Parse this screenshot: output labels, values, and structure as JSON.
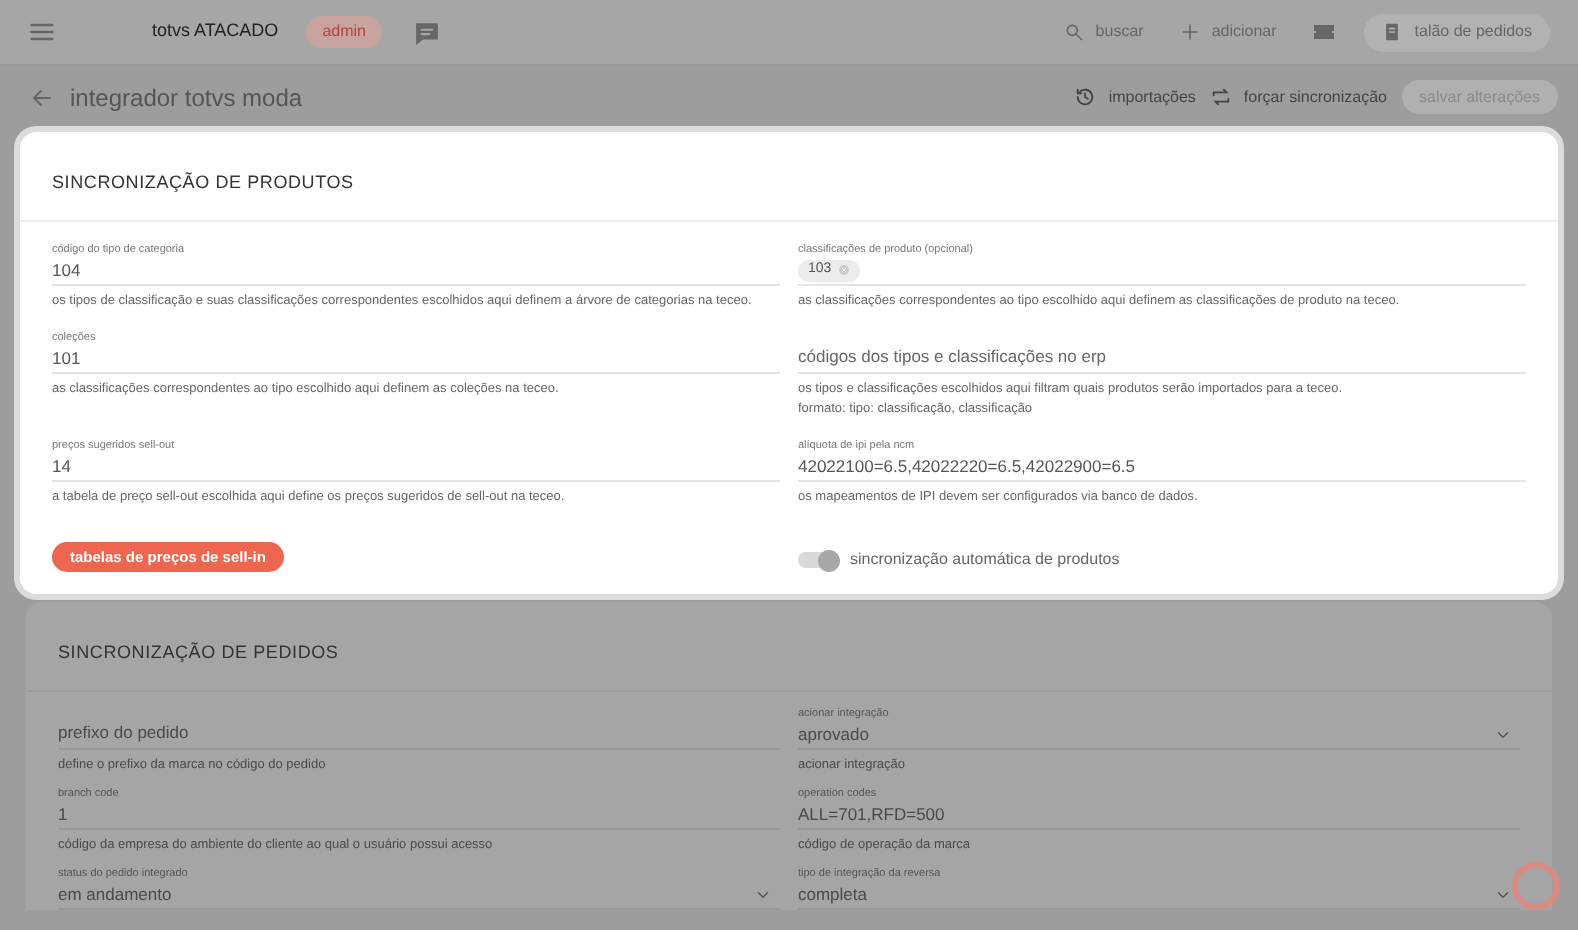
{
  "topbar": {
    "brand": "totvs ATACADO",
    "role_badge": "admin",
    "actions": [
      {
        "kind": "search",
        "label": "buscar"
      },
      {
        "kind": "add",
        "label": "adicionar"
      },
      {
        "kind": "ticket"
      }
    ],
    "orders_button": "talão de pedidos"
  },
  "subheader": {
    "title": "integrador totvs moda",
    "actions": [
      {
        "kind": "history",
        "label": "importações"
      },
      {
        "kind": "sync",
        "label": "forçar sincronização"
      }
    ],
    "save_button": {
      "label": "salvar alterações",
      "disabled": true
    }
  },
  "sections": [
    {
      "title": "SINCRONIZAÇÃO DE PRODUTOS",
      "highlighted": true,
      "rows": [
        [
          {
            "kind": "input",
            "label": "código do tipo de categoria",
            "value": "104",
            "help": [
              "os tipos de classificação e suas classificações correspondentes escolhidos aqui definem a árvore de categorias na teceo."
            ]
          },
          {
            "kind": "chips",
            "label": "classificações de produto (opcional)",
            "chips": [
              "103"
            ],
            "help": [
              "as classificações correspondentes ao tipo escolhido aqui definem as classificações de produto na teceo."
            ]
          }
        ],
        [
          {
            "kind": "input",
            "label": "coleções",
            "value": "101",
            "help": [
              "as classificações correspondentes ao tipo escolhido aqui definem as coleções na teceo."
            ]
          },
          {
            "kind": "input",
            "placeholder": "códigos dos tipos e classificações no erp",
            "help": [
              "os tipos e classificações escolhidos aqui filtram quais produtos serão importados para a teceo.",
              "formato: tipo: classificação, classificação"
            ]
          }
        ],
        [
          {
            "kind": "input",
            "label": "preços sugeridos sell-out",
            "value": "14",
            "help": [
              "a tabela de preço sell-out escolhida aqui define os preços sugeridos de sell-out na teceo."
            ]
          },
          {
            "kind": "input",
            "label": "alíquota de ipi pela ncm",
            "value": "42022100=6.5,42022220=6.5,42022900=6.5",
            "help": [
              "os mapeamentos de IPI devem ser configurados via banco de dados."
            ]
          }
        ]
      ],
      "button": "tabelas de preços de sell-in",
      "toggle": {
        "label": "sincronização automática de produtos",
        "on": true,
        "disabled": true
      }
    },
    {
      "title": "SINCRONIZAÇÃO DE PEDIDOS",
      "highlighted": false,
      "rows": [
        [
          {
            "kind": "input",
            "placeholder": "prefixo do pedido",
            "help": [
              "define o prefixo da marca no código do pedido"
            ]
          },
          {
            "kind": "select",
            "label": "acionar integração",
            "value": "aprovado",
            "help": [
              "acionar integração"
            ]
          }
        ],
        [
          {
            "kind": "input",
            "label": "branch code",
            "value": "1",
            "help": [
              "código da empresa do ambiente do cliente ao qual o usuário possui acesso"
            ]
          },
          {
            "kind": "input",
            "label": "operation codes",
            "value": "ALL=701,RFD=500",
            "help": [
              "código de operação da marca"
            ]
          }
        ],
        [
          {
            "kind": "select",
            "label": "status do pedido integrado",
            "value": "em andamento"
          },
          {
            "kind": "select",
            "label": "tipo de integração da reversa",
            "value": "completa"
          }
        ]
      ]
    }
  ]
}
